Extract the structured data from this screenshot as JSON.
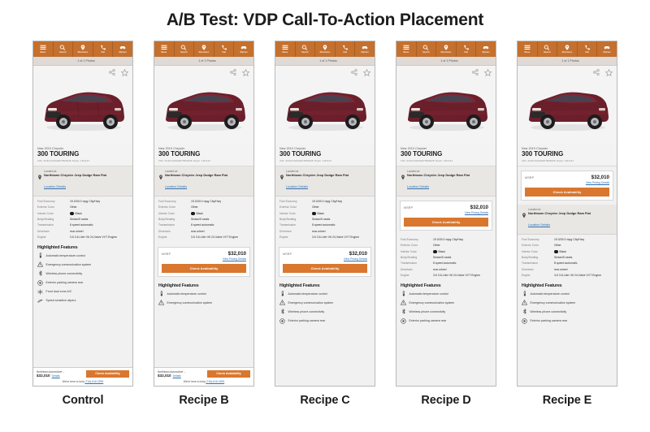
{
  "title": "A/B Test: VDP Call-To-Action Placement",
  "nav": {
    "items": [
      {
        "label": "Menu",
        "icon": "hamburger-menu-icon"
      },
      {
        "label": "Search",
        "icon": "search-icon"
      },
      {
        "label": "Directions",
        "icon": "map-pin-icon"
      },
      {
        "label": "Call",
        "icon": "phone-icon"
      },
      {
        "label": "MyCars",
        "icon": "car-icon"
      }
    ],
    "background_color": "#c4702e"
  },
  "photobar": {
    "label": "1 of 1 Photos",
    "icon": "camera-icon"
  },
  "hero": {
    "share_icon": "share-icon",
    "favorite_icon": "star-outline-icon",
    "vehicle_color": "#6b1f2b"
  },
  "vehicle": {
    "condition_year_make": "New 2019 Chrysler",
    "model": "300 TOURING",
    "vin_stock": "VIN: 2C3CCA0G9KH503025   Stock: 19C137"
  },
  "location": {
    "located_at_label": "Located at:",
    "dealer_name": "Northtown Chrysler Jeep Dodge Ram Fiat",
    "details_link": "Location Details",
    "pin_icon": "map-pin-icon"
  },
  "price": {
    "label": "MSRP",
    "value": "$32,010",
    "details_link": "View Pricing Details",
    "cta_label": "Check Availability",
    "cta_color": "#d9772f"
  },
  "specs": {
    "rows": [
      {
        "key": "Fuel Economy",
        "value": "19.0/30.0 mpg City/Hwy",
        "has_info": true
      },
      {
        "key": "Exterior Color",
        "value": "Other",
        "has_info": false
      },
      {
        "key": "Interior Color",
        "value": "Black",
        "swatch": "#1a1a1a",
        "has_info": false
      },
      {
        "key": "Body/Seating",
        "value": "Sedan/5 seats",
        "has_info": false
      },
      {
        "key": "Transmission",
        "value": "8 speed automatic",
        "has_info": false
      },
      {
        "key": "Drivetrain",
        "value": "rear-wheel",
        "has_info": false
      },
      {
        "key": "Engine",
        "value": "3.6 3.6-Liter V6 24-Valve VVT Engine",
        "has_info": false
      }
    ]
  },
  "features": {
    "heading": "Highlighted Features",
    "items": [
      {
        "label": "Automatic temperature control",
        "icon": "thermometer-icon"
      },
      {
        "label": "Emergency communication system",
        "icon": "warning-triangle-icon"
      },
      {
        "label": "Wireless phone connectivity",
        "icon": "bluetooth-icon"
      },
      {
        "label": "Exterior parking camera rear",
        "icon": "camera-lens-icon"
      },
      {
        "label": "Front dual zone A/C",
        "icon": "snowflake-icon"
      },
      {
        "label": "Speed sensitive wipers",
        "icon": "wiper-icon"
      }
    ]
  },
  "sticky": {
    "dealer": "Northtown Automotive'...",
    "price": "$32,010",
    "details_link": "Details",
    "cta_label": "Check Availability",
    "help_prefix": "We're here to help ",
    "help_phone": "(716)-616-3299"
  },
  "variants": [
    {
      "id": "control",
      "caption": "Control",
      "price_position": "none"
    },
    {
      "id": "recipe-b",
      "caption": "Recipe B",
      "price_position": "below-specs"
    },
    {
      "id": "recipe-c",
      "caption": "Recipe C",
      "price_position": "above-features"
    },
    {
      "id": "recipe-d",
      "caption": "Recipe D",
      "price_position": "above-specs"
    },
    {
      "id": "recipe-e",
      "caption": "Recipe E",
      "price_position": "top"
    }
  ]
}
